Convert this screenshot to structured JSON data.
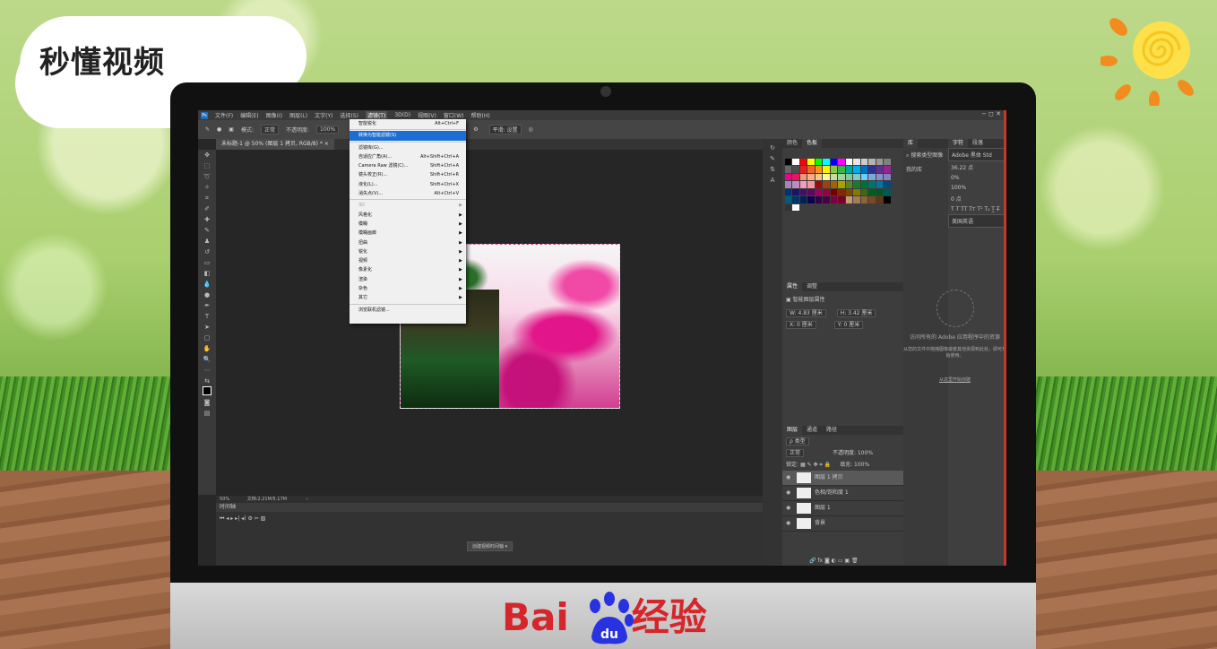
{
  "watermark": {
    "brand": "秒懂视频",
    "footer_brand": "Bai",
    "footer_du": "du",
    "footer_cn": "经验"
  },
  "menubar": {
    "app_icon": "Ps",
    "items": [
      "文件(F)",
      "编辑(E)",
      "图像(I)",
      "图层(L)",
      "文字(Y)",
      "选择(S)",
      "滤镜(T)",
      "3D(D)",
      "视图(V)",
      "窗口(W)",
      "帮助(H)"
    ],
    "window_controls": "−  ◻  ✕"
  },
  "optionsbar": {
    "mode_label": "模式:",
    "mode_value": "正常",
    "opacity_label": "不透明度:",
    "opacity_value": "100%",
    "smooth_label": "平滑: 设置"
  },
  "document": {
    "tab_title": "未标题-1 @ 50% (图层 1 拷贝, RGB/8) *",
    "zoom": "50%",
    "doc_size": "文档:2.21M/5.17M"
  },
  "filter_menu": {
    "items": [
      {
        "label": "智能锐化",
        "shortcut": "Alt+Ctrl+F",
        "type": "item"
      },
      {
        "type": "sep"
      },
      {
        "label": "转换为智能滤镜(S)",
        "shortcut": "",
        "type": "selected"
      },
      {
        "type": "sep"
      },
      {
        "label": "滤镜库(G)...",
        "shortcut": "",
        "type": "item"
      },
      {
        "label": "自适应广角(A)...",
        "shortcut": "Alt+Shift+Ctrl+A",
        "type": "item"
      },
      {
        "label": "Camera Raw 滤镜(C)...",
        "shortcut": "Shift+Ctrl+A",
        "type": "item"
      },
      {
        "label": "镜头校正(R)...",
        "shortcut": "Shift+Ctrl+R",
        "type": "item"
      },
      {
        "label": "液化(L)...",
        "shortcut": "Shift+Ctrl+X",
        "type": "item"
      },
      {
        "label": "消失点(V)...",
        "shortcut": "Alt+Ctrl+V",
        "type": "item"
      },
      {
        "type": "sep"
      },
      {
        "label": "3D",
        "shortcut": "",
        "type": "disabled-sub"
      },
      {
        "label": "风格化",
        "shortcut": "",
        "type": "sub"
      },
      {
        "label": "模糊",
        "shortcut": "",
        "type": "sub"
      },
      {
        "label": "模糊画廊",
        "shortcut": "",
        "type": "sub"
      },
      {
        "label": "扭曲",
        "shortcut": "",
        "type": "sub"
      },
      {
        "label": "锐化",
        "shortcut": "",
        "type": "sub"
      },
      {
        "label": "视频",
        "shortcut": "",
        "type": "sub"
      },
      {
        "label": "像素化",
        "shortcut": "",
        "type": "sub"
      },
      {
        "label": "渲染",
        "shortcut": "",
        "type": "sub"
      },
      {
        "label": "杂色",
        "shortcut": "",
        "type": "sub"
      },
      {
        "label": "其它",
        "shortcut": "",
        "type": "sub"
      },
      {
        "type": "sep"
      },
      {
        "label": "浏览联机滤镜...",
        "shortcut": "",
        "type": "item"
      }
    ]
  },
  "timeline": {
    "title": "时间轴",
    "create_button": "创建视频时间轴"
  },
  "panels": {
    "swatch_tabs": [
      "颜色",
      "色板"
    ],
    "properties_tabs": [
      "属性",
      "调整"
    ],
    "properties_title": "智能图层属性",
    "prop_w": "W: 4.83 厘米",
    "prop_h": "H: 3.42 厘米",
    "prop_x": "X: 0 厘米",
    "prop_y": "Y: 0 厘米",
    "layers_tabs": [
      "图层",
      "通道",
      "路径"
    ],
    "layer_filter": "ρ 类型",
    "blend_mode": "正常",
    "opacity": "不透明度: 100%",
    "lock_label": "锁定:",
    "fill": "填充: 100%",
    "layers": [
      {
        "name": "图层 1 拷贝",
        "selected": true
      },
      {
        "name": "色相/饱和度 1",
        "selected": false
      },
      {
        "name": "图层 1",
        "selected": false
      },
      {
        "name": "背景",
        "selected": false
      }
    ]
  },
  "library": {
    "tab": "库",
    "my_library": "我的库",
    "search_placeholder": "搜索类型图像",
    "learn_text": "访问所有的 Adobe 应用程序中的资源",
    "learn_sub": "从您的文件中拖拽图像或者其他资源到此处，即可开始使用。",
    "link": "从这里开始创建"
  },
  "character": {
    "tabs": [
      "字符",
      "段落"
    ],
    "font": "Adobe 黑体 Std",
    "size": "36.22 点",
    "tracking": "0%",
    "scale": "100%",
    "baseline": "0 点",
    "lang": "美国英语"
  },
  "swatch_colors": [
    "#000000",
    "#ffffff",
    "#ff0000",
    "#ffff00",
    "#00ff00",
    "#00ffff",
    "#0000ff",
    "#ff00ff",
    "#ffffff",
    "#e6e6e6",
    "#cccccc",
    "#b3b3b3",
    "#999999",
    "#808080",
    "#666666",
    "#4d4d4d",
    "#ed1c24",
    "#f26522",
    "#f7941d",
    "#fff200",
    "#8dc63f",
    "#39b54a",
    "#00a99d",
    "#00aeef",
    "#0072bc",
    "#2e3192",
    "#662d91",
    "#92278f",
    "#ec008c",
    "#ed145b",
    "#f69679",
    "#f9ad81",
    "#fdc689",
    "#fff799",
    "#c4df9b",
    "#a3d39c",
    "#82ca9c",
    "#7accc8",
    "#6dcff6",
    "#7da7d9",
    "#8393ca",
    "#8781bd",
    "#a186be",
    "#bd8cbf",
    "#f49ac1",
    "#f5989d",
    "#9e0b0f",
    "#a0410d",
    "#a36209",
    "#aba000",
    "#598527",
    "#1a7b30",
    "#007236",
    "#00746b",
    "#0076a3",
    "#004b80",
    "#003471",
    "#1b1464",
    "#440e62",
    "#630460",
    "#9e005d",
    "#9e0039",
    "#790000",
    "#7b2e00",
    "#7d4900",
    "#827b00",
    "#406618",
    "#005e20",
    "#005826",
    "#005952",
    "#005b7f",
    "#003663",
    "#002157",
    "#0d004c",
    "#32004b",
    "#4b0049",
    "#7b0046",
    "#7a0026",
    "#c69c6d",
    "#a67c52",
    "#8c6239",
    "#754c24",
    "#603913",
    "#000000",
    "#333333",
    "#ffffff"
  ]
}
